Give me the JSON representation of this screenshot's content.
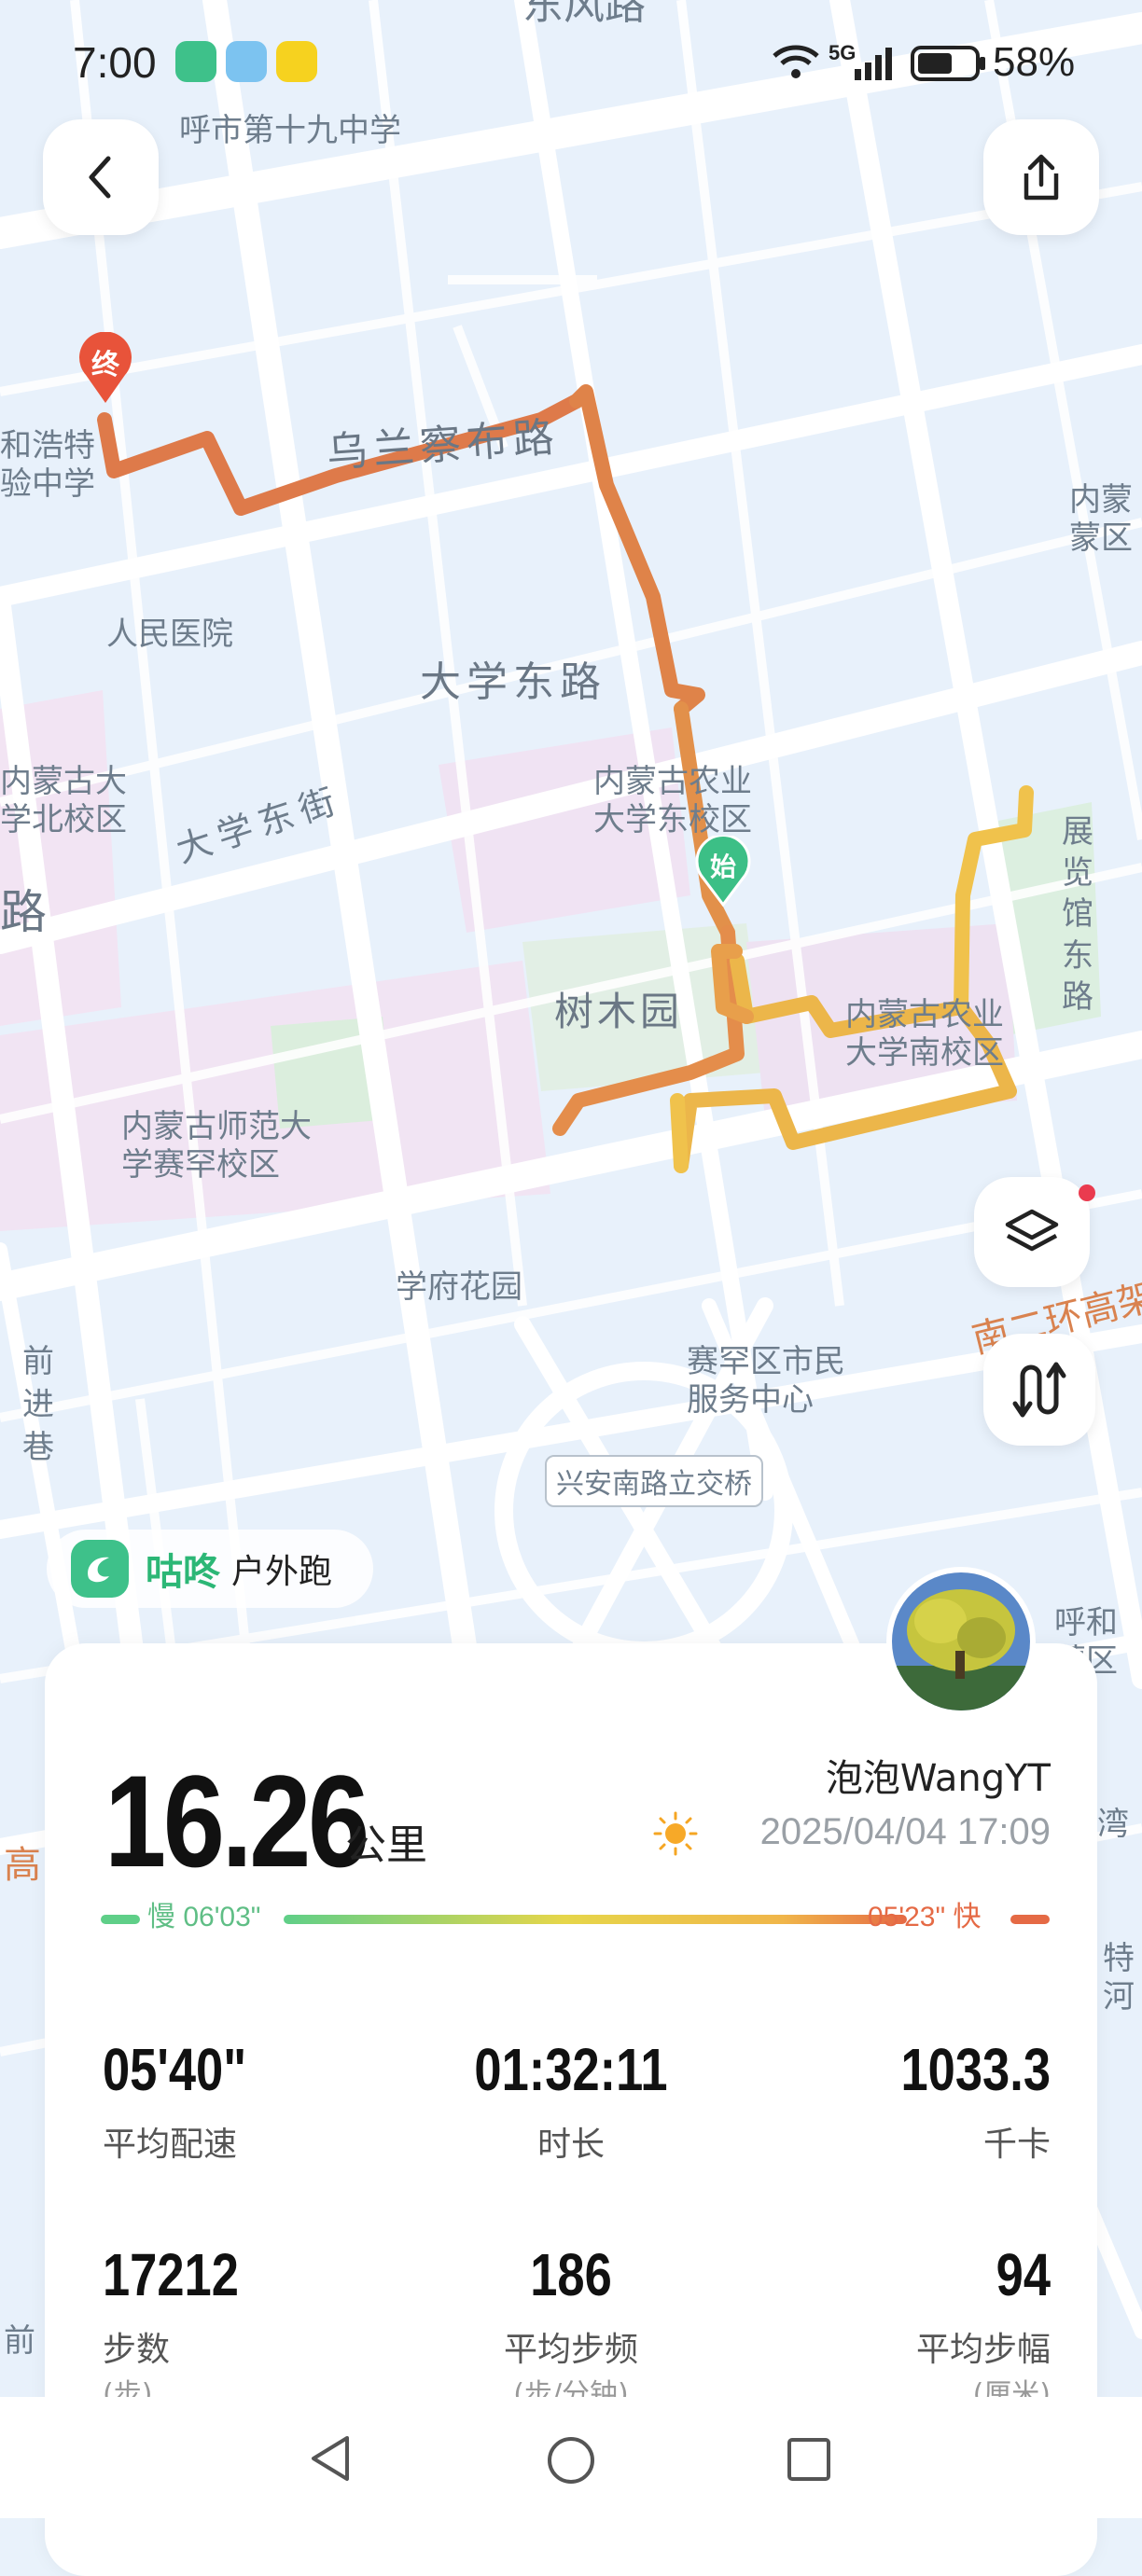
{
  "status_bar": {
    "time": "7:00",
    "battery": "58%",
    "network": "5G"
  },
  "map": {
    "labels": [
      {
        "id": "school19",
        "text": "呼市第十九中学"
      },
      {
        "id": "wulanchabu",
        "text": "乌兰察布路"
      },
      {
        "id": "hospital",
        "text": "人民医院"
      },
      {
        "id": "daxuedonglu",
        "text": "大学东路"
      },
      {
        "id": "nmgu_north",
        "text": "内蒙古大\n学北校区"
      },
      {
        "id": "daxuedongjie",
        "text": "大学东街"
      },
      {
        "id": "nmau",
        "text": "内蒙古农业\n大学东校区"
      },
      {
        "id": "shumuyuan",
        "text": "树木园"
      },
      {
        "id": "nmau_south",
        "text": "内蒙古农业\n大学南校区"
      },
      {
        "id": "normal",
        "text": "内蒙古师范大\n学赛罕校区"
      },
      {
        "id": "xuefu",
        "text": "学府花园"
      },
      {
        "id": "saihan",
        "text": "赛罕区市民\n服务中心"
      },
      {
        "id": "xingan",
        "text": "兴安南路立交桥"
      },
      {
        "id": "qianjin",
        "text": "前\n进\n巷"
      },
      {
        "id": "zhanlanguan",
        "text": "展\n览\n馆\n东\n路"
      },
      {
        "id": "nanerhuan",
        "text": "南二环高架"
      },
      {
        "id": "left_school",
        "text": "和浩特\n验中学"
      },
      {
        "id": "left_road",
        "text": "路"
      },
      {
        "id": "right_nmg",
        "text": "内蒙\n蒙区"
      },
      {
        "id": "right_huhe",
        "text": "呼和\n蒙区"
      },
      {
        "id": "right_wan",
        "text": "湾"
      },
      {
        "id": "right_te",
        "text": "特\n河"
      },
      {
        "id": "left_gao",
        "text": "高"
      },
      {
        "id": "left_qian",
        "text": "前"
      },
      {
        "id": "top_road",
        "text": "东风路"
      }
    ],
    "end_marker": "终",
    "start_marker": "始"
  },
  "app": {
    "name": "咕咚",
    "activity": "户外跑"
  },
  "summary": {
    "distance": "16.26",
    "unit": "公里",
    "user": "泡泡WangYT",
    "datetime": "2025/04/04 17:09",
    "pace_slow": "慢 06'03\"",
    "pace_fast": "05'23\" 快"
  },
  "stats": [
    {
      "value": "05'40\"",
      "label": "平均配速",
      "sub": ""
    },
    {
      "value": "01:32:11",
      "label": "时长",
      "sub": ""
    },
    {
      "value": "1033.3",
      "label": "千卡",
      "sub": ""
    },
    {
      "value": "17212",
      "label": "步数",
      "sub": "(步)"
    },
    {
      "value": "186",
      "label": "平均步频",
      "sub": "(步/分钟)"
    },
    {
      "value": "94",
      "label": "平均步幅",
      "sub": "(厘米)"
    }
  ],
  "colors": {
    "accent": "#2cb776",
    "route_fast": "#e07044",
    "route_slow": "#f0c84a",
    "card": "#ffffff"
  }
}
